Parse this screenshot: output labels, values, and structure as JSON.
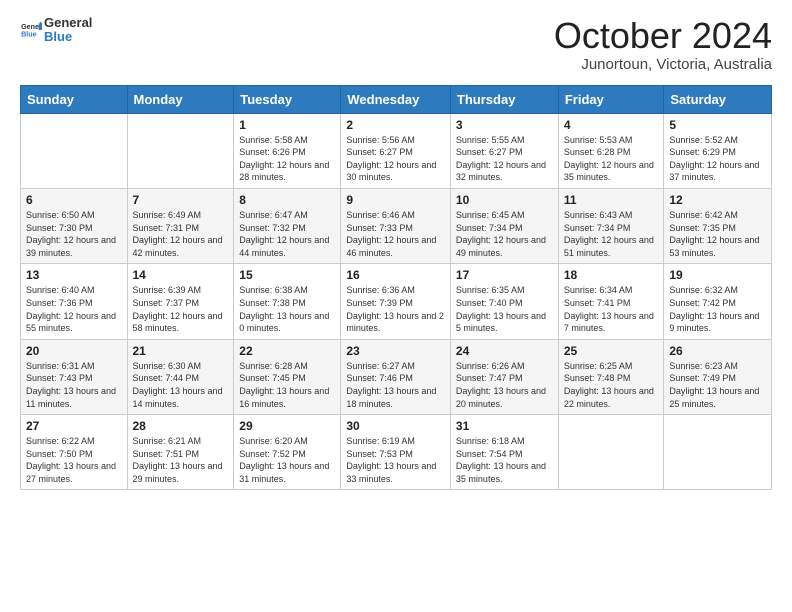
{
  "logo": {
    "general": "General",
    "blue": "Blue"
  },
  "header": {
    "month": "October 2024",
    "location": "Junortoun, Victoria, Australia"
  },
  "days_of_week": [
    "Sunday",
    "Monday",
    "Tuesday",
    "Wednesday",
    "Thursday",
    "Friday",
    "Saturday"
  ],
  "weeks": [
    [
      null,
      null,
      {
        "day": "1",
        "sunrise": "Sunrise: 5:58 AM",
        "sunset": "Sunset: 6:26 PM",
        "daylight": "Daylight: 12 hours and 28 minutes."
      },
      {
        "day": "2",
        "sunrise": "Sunrise: 5:56 AM",
        "sunset": "Sunset: 6:27 PM",
        "daylight": "Daylight: 12 hours and 30 minutes."
      },
      {
        "day": "3",
        "sunrise": "Sunrise: 5:55 AM",
        "sunset": "Sunset: 6:27 PM",
        "daylight": "Daylight: 12 hours and 32 minutes."
      },
      {
        "day": "4",
        "sunrise": "Sunrise: 5:53 AM",
        "sunset": "Sunset: 6:28 PM",
        "daylight": "Daylight: 12 hours and 35 minutes."
      },
      {
        "day": "5",
        "sunrise": "Sunrise: 5:52 AM",
        "sunset": "Sunset: 6:29 PM",
        "daylight": "Daylight: 12 hours and 37 minutes."
      }
    ],
    [
      {
        "day": "6",
        "sunrise": "Sunrise: 6:50 AM",
        "sunset": "Sunset: 7:30 PM",
        "daylight": "Daylight: 12 hours and 39 minutes."
      },
      {
        "day": "7",
        "sunrise": "Sunrise: 6:49 AM",
        "sunset": "Sunset: 7:31 PM",
        "daylight": "Daylight: 12 hours and 42 minutes."
      },
      {
        "day": "8",
        "sunrise": "Sunrise: 6:47 AM",
        "sunset": "Sunset: 7:32 PM",
        "daylight": "Daylight: 12 hours and 44 minutes."
      },
      {
        "day": "9",
        "sunrise": "Sunrise: 6:46 AM",
        "sunset": "Sunset: 7:33 PM",
        "daylight": "Daylight: 12 hours and 46 minutes."
      },
      {
        "day": "10",
        "sunrise": "Sunrise: 6:45 AM",
        "sunset": "Sunset: 7:34 PM",
        "daylight": "Daylight: 12 hours and 49 minutes."
      },
      {
        "day": "11",
        "sunrise": "Sunrise: 6:43 AM",
        "sunset": "Sunset: 7:34 PM",
        "daylight": "Daylight: 12 hours and 51 minutes."
      },
      {
        "day": "12",
        "sunrise": "Sunrise: 6:42 AM",
        "sunset": "Sunset: 7:35 PM",
        "daylight": "Daylight: 12 hours and 53 minutes."
      }
    ],
    [
      {
        "day": "13",
        "sunrise": "Sunrise: 6:40 AM",
        "sunset": "Sunset: 7:36 PM",
        "daylight": "Daylight: 12 hours and 55 minutes."
      },
      {
        "day": "14",
        "sunrise": "Sunrise: 6:39 AM",
        "sunset": "Sunset: 7:37 PM",
        "daylight": "Daylight: 12 hours and 58 minutes."
      },
      {
        "day": "15",
        "sunrise": "Sunrise: 6:38 AM",
        "sunset": "Sunset: 7:38 PM",
        "daylight": "Daylight: 13 hours and 0 minutes."
      },
      {
        "day": "16",
        "sunrise": "Sunrise: 6:36 AM",
        "sunset": "Sunset: 7:39 PM",
        "daylight": "Daylight: 13 hours and 2 minutes."
      },
      {
        "day": "17",
        "sunrise": "Sunrise: 6:35 AM",
        "sunset": "Sunset: 7:40 PM",
        "daylight": "Daylight: 13 hours and 5 minutes."
      },
      {
        "day": "18",
        "sunrise": "Sunrise: 6:34 AM",
        "sunset": "Sunset: 7:41 PM",
        "daylight": "Daylight: 13 hours and 7 minutes."
      },
      {
        "day": "19",
        "sunrise": "Sunrise: 6:32 AM",
        "sunset": "Sunset: 7:42 PM",
        "daylight": "Daylight: 13 hours and 9 minutes."
      }
    ],
    [
      {
        "day": "20",
        "sunrise": "Sunrise: 6:31 AM",
        "sunset": "Sunset: 7:43 PM",
        "daylight": "Daylight: 13 hours and 11 minutes."
      },
      {
        "day": "21",
        "sunrise": "Sunrise: 6:30 AM",
        "sunset": "Sunset: 7:44 PM",
        "daylight": "Daylight: 13 hours and 14 minutes."
      },
      {
        "day": "22",
        "sunrise": "Sunrise: 6:28 AM",
        "sunset": "Sunset: 7:45 PM",
        "daylight": "Daylight: 13 hours and 16 minutes."
      },
      {
        "day": "23",
        "sunrise": "Sunrise: 6:27 AM",
        "sunset": "Sunset: 7:46 PM",
        "daylight": "Daylight: 13 hours and 18 minutes."
      },
      {
        "day": "24",
        "sunrise": "Sunrise: 6:26 AM",
        "sunset": "Sunset: 7:47 PM",
        "daylight": "Daylight: 13 hours and 20 minutes."
      },
      {
        "day": "25",
        "sunrise": "Sunrise: 6:25 AM",
        "sunset": "Sunset: 7:48 PM",
        "daylight": "Daylight: 13 hours and 22 minutes."
      },
      {
        "day": "26",
        "sunrise": "Sunrise: 6:23 AM",
        "sunset": "Sunset: 7:49 PM",
        "daylight": "Daylight: 13 hours and 25 minutes."
      }
    ],
    [
      {
        "day": "27",
        "sunrise": "Sunrise: 6:22 AM",
        "sunset": "Sunset: 7:50 PM",
        "daylight": "Daylight: 13 hours and 27 minutes."
      },
      {
        "day": "28",
        "sunrise": "Sunrise: 6:21 AM",
        "sunset": "Sunset: 7:51 PM",
        "daylight": "Daylight: 13 hours and 29 minutes."
      },
      {
        "day": "29",
        "sunrise": "Sunrise: 6:20 AM",
        "sunset": "Sunset: 7:52 PM",
        "daylight": "Daylight: 13 hours and 31 minutes."
      },
      {
        "day": "30",
        "sunrise": "Sunrise: 6:19 AM",
        "sunset": "Sunset: 7:53 PM",
        "daylight": "Daylight: 13 hours and 33 minutes."
      },
      {
        "day": "31",
        "sunrise": "Sunrise: 6:18 AM",
        "sunset": "Sunset: 7:54 PM",
        "daylight": "Daylight: 13 hours and 35 minutes."
      },
      null,
      null
    ]
  ]
}
